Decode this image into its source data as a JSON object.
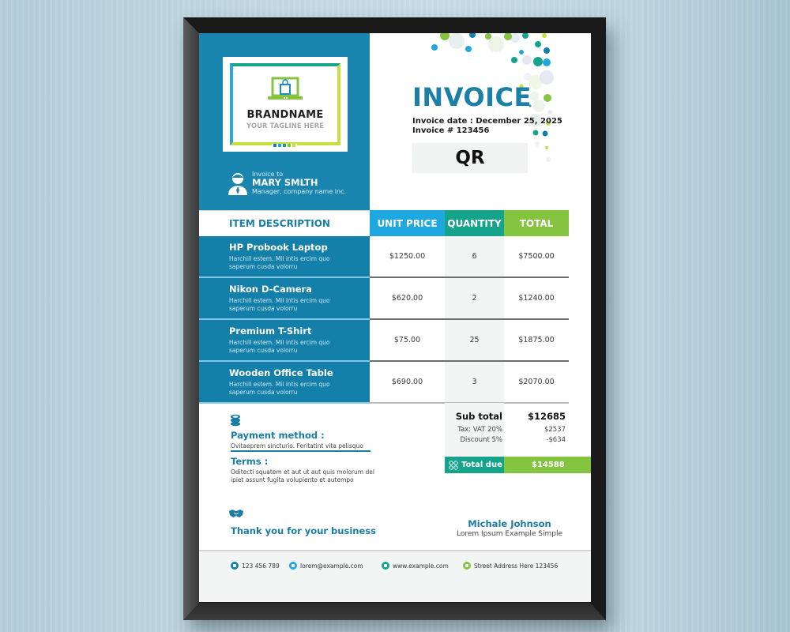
{
  "brand": {
    "name": "BRANDNAME",
    "tagline": "YOUR TAGLINE HERE",
    "logo_icon": "laptop-shopping-bag-icon"
  },
  "client": {
    "label": "Invoice to",
    "name": "MARY SMLTH",
    "role": "Manager, company name inc.",
    "icon": "person-icon"
  },
  "invoice": {
    "title": "INVOICE",
    "date_line": "Invoice date : December 25, 2025",
    "number_line": "Invoice # 123456",
    "qr_label": "QR"
  },
  "table": {
    "headers": {
      "description": "ITEM DESCRIPTION",
      "unit_price": "UNIT PRICE",
      "quantity": "QUANTITY",
      "total": "TOTAL"
    },
    "rows": [
      {
        "name": "HP Probook Laptop",
        "desc1": "Harchill estem. Mil intis ercim quo",
        "desc2": "saperum cusda volorru",
        "unit_price": "$1250.00",
        "quantity": "6",
        "total": "$7500.00"
      },
      {
        "name": "Nikon D-Camera",
        "desc1": "Harchill estem. Mil intis ercim quo",
        "desc2": "saperum cusda volorru",
        "unit_price": "$620.00",
        "quantity": "2",
        "total": "$1240.00"
      },
      {
        "name": "Premium T-Shirt",
        "desc1": "Harchill estem. Mil intis ercim quo",
        "desc2": "saperum cusda volorru",
        "unit_price": "$75.00",
        "quantity": "25",
        "total": "$1875.00"
      },
      {
        "name": "Wooden Office Table",
        "desc1": "Harchill estem. Mil intis ercim quo",
        "desc2": "saperum cusda volorru",
        "unit_price": "$690.00",
        "quantity": "3",
        "total": "$2070.00"
      }
    ]
  },
  "summary": {
    "subtotal_label": "Sub total",
    "subtotal_value": "$12685",
    "tax_label": "Tax: VAT 20%",
    "tax_value": "$2537",
    "discount_label": "Discount 5%",
    "discount_value": "-$634",
    "total_due_label": "Total due",
    "total_due_value": "$14588"
  },
  "payment": {
    "title": "Payment method :",
    "text": "Ovitaeprem sincturio. Feritatint vita pelisquo",
    "icon": "coins-icon"
  },
  "terms": {
    "title": "Terms :",
    "text": "Oditecti squatem et aut ut aut quis molorum del ipiet assunt fugita volupiento et autempo"
  },
  "closing": {
    "thanks": "Thank you for your business",
    "icon": "handshake-icon",
    "signer_name": "Michale Johnson",
    "signer_role": "Lorem  Ipsum Example Simple"
  },
  "footer": {
    "phone": "123 456 789",
    "email": "lorem@example.com",
    "website": "www.example.com",
    "address": "Street Address Here 123456"
  },
  "colors": {
    "primary_blue": "#1480a9",
    "light_blue": "#1fa7df",
    "teal": "#15a48b",
    "green": "#85c441",
    "lime": "#c6df3f"
  }
}
